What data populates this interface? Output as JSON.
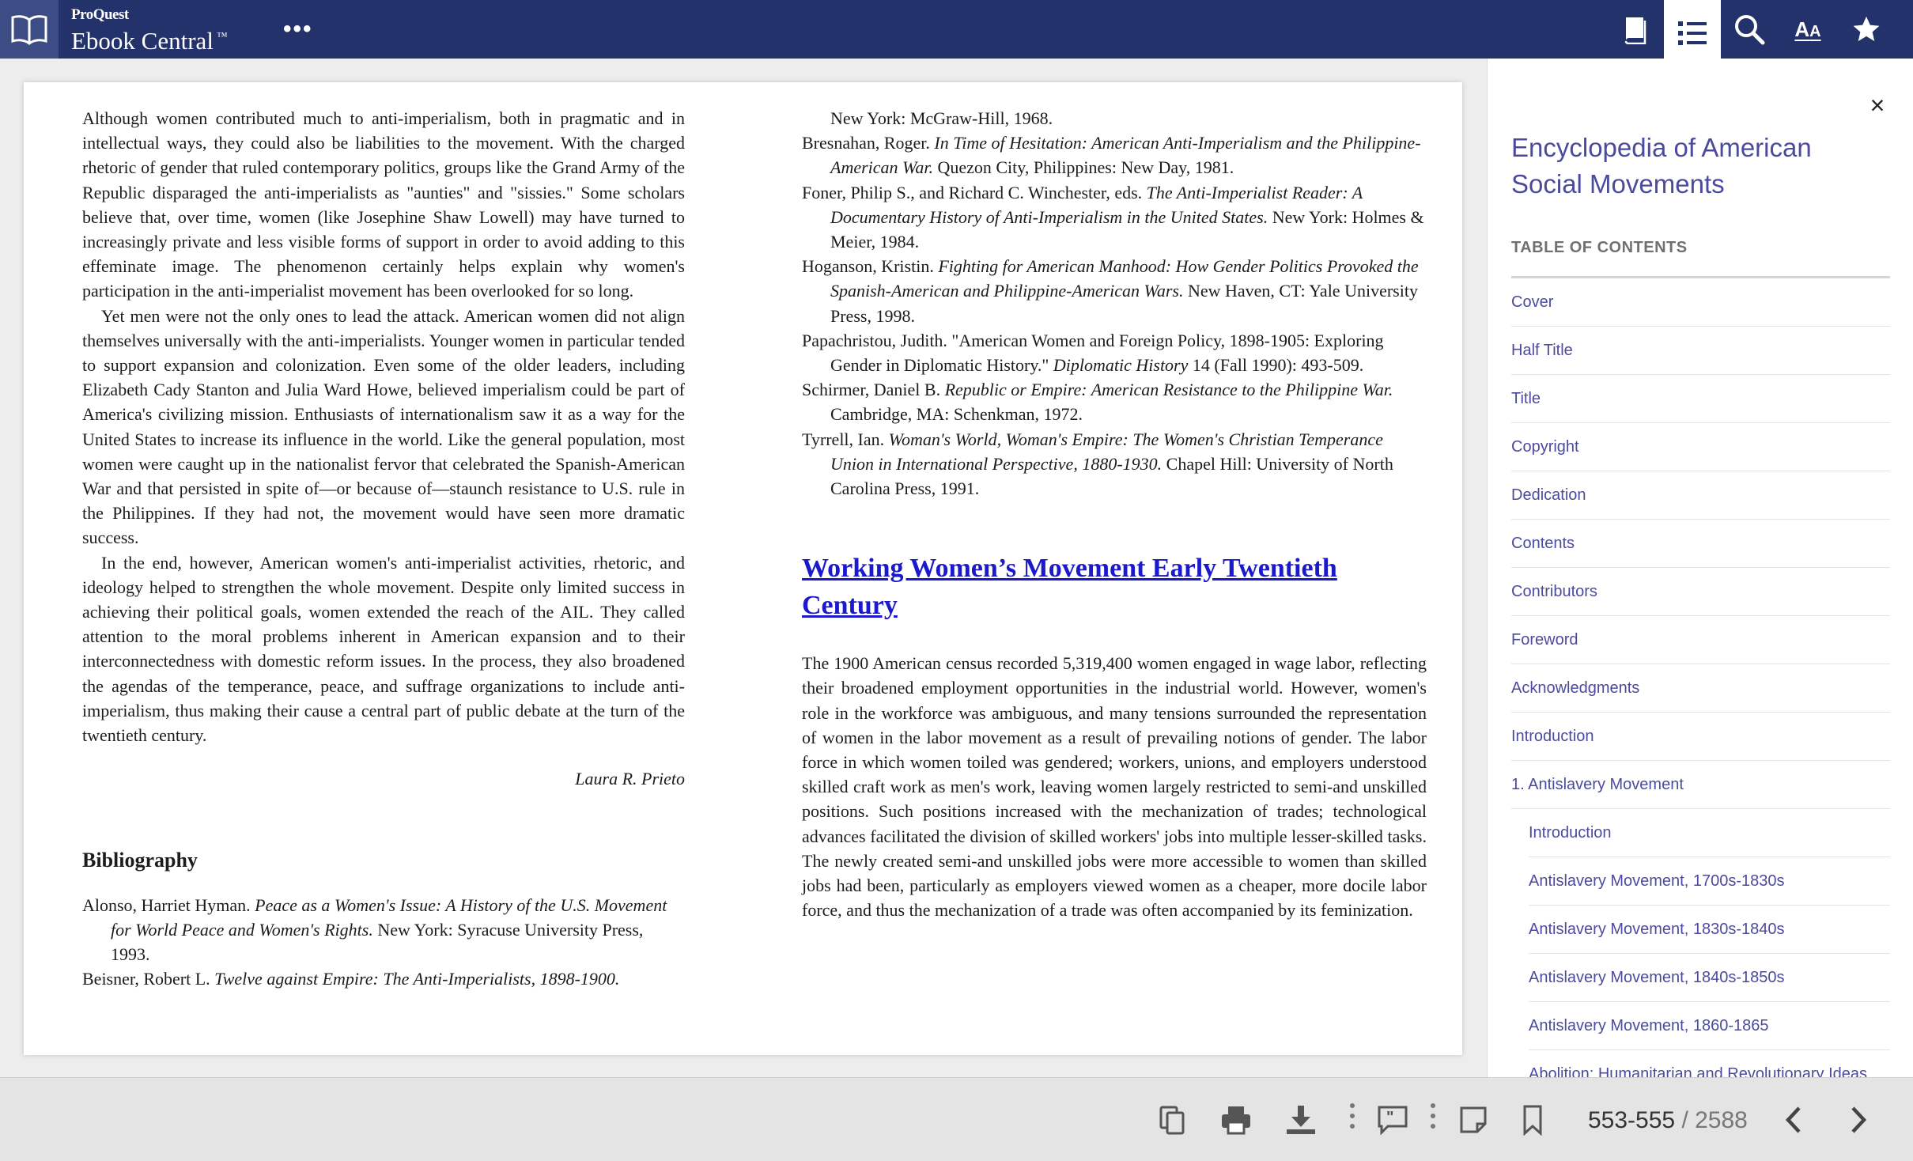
{
  "header": {
    "brand_small": "ProQuest",
    "brand_name": "Ebook Central",
    "trademark": "™",
    "more_icon": "•••",
    "icons": [
      "book-view-icon",
      "table-of-contents-icon",
      "search-icon",
      "text-size-icon",
      "favorite-star-icon"
    ],
    "text_size_big": "A",
    "text_size_small": "A",
    "colors": {
      "bar": "#23326b",
      "active_tab": "#ffffff"
    }
  },
  "left_column": {
    "paragraphs": [
      "Although women contributed much to anti-imperialism, both in pragmatic and in intellectual ways, they could also be liabilities to the movement. With the charged rhetoric of gender that ruled contemporary politics, groups like the Grand Army of the Republic disparaged the anti-imperialists as \"aunties\" and \"sissies.\" Some scholars believe that, over time, women (like Josephine Shaw Lowell) may have turned to increasingly private and less visible forms of support in order to avoid adding to this effeminate image. The phenomenon certainly helps explain why women's participation in the anti-imperialist movement has been overlooked for so long.",
      "Yet men were not the only ones to lead the attack. American women did not align themselves universally with the anti-imperialists. Younger women in particular tended to support expansion and colonization. Even some of the older leaders, including Elizabeth Cady Stanton and Julia Ward Howe, believed imperialism could be part of America's civilizing mission. Enthusiasts of internationalism saw it as a way for the United States to increase its influence in the world. Like the general population, most women were caught up in the nationalist fervor that celebrated the Spanish-American War and that persisted in spite of—or because of—staunch resistance to U.S. rule in the Philippines. If they had not, the movement would have seen more dramatic success.",
      "In the end, however, American women's anti-imperialist activities, rhetoric, and ideology helped to strengthen the whole movement. Despite only limited success in achieving their political goals, women extended the reach of the AIL. They called attention to the moral problems inherent in American expansion and to their interconnectedness with domestic reform issues. In the process, they also broadened the agendas of the temperance, peace, and suffrage organizations to include anti-imperialism, thus making their cause a central part of public debate at the turn of the twentieth century."
    ],
    "author": "Laura R. Prieto",
    "bibliography_title": "Bibliography",
    "bibliography": [
      {
        "pre": "Alonso, Harriet Hyman. ",
        "title": "Peace as a Women's Issue: A History of the U.S. Movement for World Peace and Women's Rights.",
        "post": " New York: Syracuse University Press, 1993."
      },
      {
        "pre": "Beisner, Robert L. ",
        "title": "Twelve against Empire: The Anti-Imperialists, 1898-1900.",
        "post": ""
      }
    ]
  },
  "right_column": {
    "continued_ref": "New York: McGraw-Hill, 1968.",
    "bibliography": [
      {
        "pre": "Bresnahan, Roger. ",
        "title": "In Time of Hesitation: American Anti-Imperialism and the Philippine-American War.",
        "post": " Quezon City, Philippines: New Day, 1981."
      },
      {
        "pre": "Foner, Philip S., and Richard C. Winchester, eds. ",
        "title": "The Anti-Imperialist Reader: A Documentary History of Anti-Imperialism in the United States.",
        "post": " New York: Holmes & Meier, 1984."
      },
      {
        "pre": "Hoganson, Kristin. ",
        "title": "Fighting for American Manhood: How Gender Politics Provoked the Spanish-American and Philippine-American Wars.",
        "post": " New Haven, CT: Yale University Press, 1998."
      },
      {
        "pre": "Papachristou, Judith. \"American Women and Foreign Policy, 1898-1905: Exploring Gender in Diplomatic History.\" ",
        "title": "Diplomatic History",
        "post": " 14 (Fall 1990): 493-509."
      },
      {
        "pre": "Schirmer, Daniel B. ",
        "title": "Republic or Empire: American Resistance to the Philippine War.",
        "post": " Cambridge, MA: Schenkman, 1972."
      },
      {
        "pre": "Tyrrell, Ian. ",
        "title": "Woman's World, Woman's Empire: The Women's Christian Temperance Union in International Perspective, 1880-1930.",
        "post": " Chapel Hill: University of North Carolina Press, 1991."
      }
    ],
    "chapter_link": "Working Women’s Movement Early Twentieth Century",
    "chapter_paragraph": "The 1900 American census recorded 5,319,400 women engaged in wage labor, reflecting their broadened employment opportunities in the industrial world. However, women's role in the workforce was ambiguous, and many tensions surrounded the representation of women in the labor movement as a result of prevailing notions of gender. The labor force in which women toiled was gendered; workers, unions, and employers understood skilled craft work as men's work, leaving women largely restricted to semi-and unskilled positions. Such positions increased with the mechanization of trades; technological advances facilitated the division of skilled workers' jobs into multiple lesser-skilled tasks. The newly created semi-and unskilled jobs were more accessible to women than skilled jobs had been, particularly as employers viewed women as a cheaper, more docile labor force, and thus the mechanization of a trade was often accompanied by its feminization."
  },
  "sidebar": {
    "close_icon": "×",
    "book_title": "Encyclopedia of American Social Movements",
    "toc_heading": "TABLE OF CONTENTS",
    "items": [
      {
        "label": "Cover",
        "level": 0
      },
      {
        "label": "Half Title",
        "level": 0
      },
      {
        "label": "Title",
        "level": 0
      },
      {
        "label": "Copyright",
        "level": 0
      },
      {
        "label": "Dedication",
        "level": 0
      },
      {
        "label": "Contents",
        "level": 0
      },
      {
        "label": "Contributors",
        "level": 0
      },
      {
        "label": "Foreword",
        "level": 0
      },
      {
        "label": "Acknowledgments",
        "level": 0
      },
      {
        "label": "Introduction",
        "level": 0
      },
      {
        "label": "1. Antislavery Movement",
        "level": 0
      },
      {
        "label": "Introduction",
        "level": 1
      },
      {
        "label": "Antislavery Movement, 1700s-1830s",
        "level": 1
      },
      {
        "label": "Antislavery Movement, 1830s-1840s",
        "level": 1
      },
      {
        "label": "Antislavery Movement, 1840s-1850s",
        "level": 1
      },
      {
        "label": "Antislavery Movement, 1860-1865",
        "level": 1
      },
      {
        "label": "Abolition: Humanitarian and Revolutionary Ideas",
        "level": 1
      }
    ]
  },
  "footer": {
    "icons": [
      "copy-icon",
      "print-icon",
      "download-icon",
      "cite-icon",
      "add-note-icon",
      "bookmark-icon",
      "previous-page-icon",
      "next-page-icon"
    ],
    "page_range": "553-555",
    "page_separator": " / ",
    "page_total": "2588"
  }
}
